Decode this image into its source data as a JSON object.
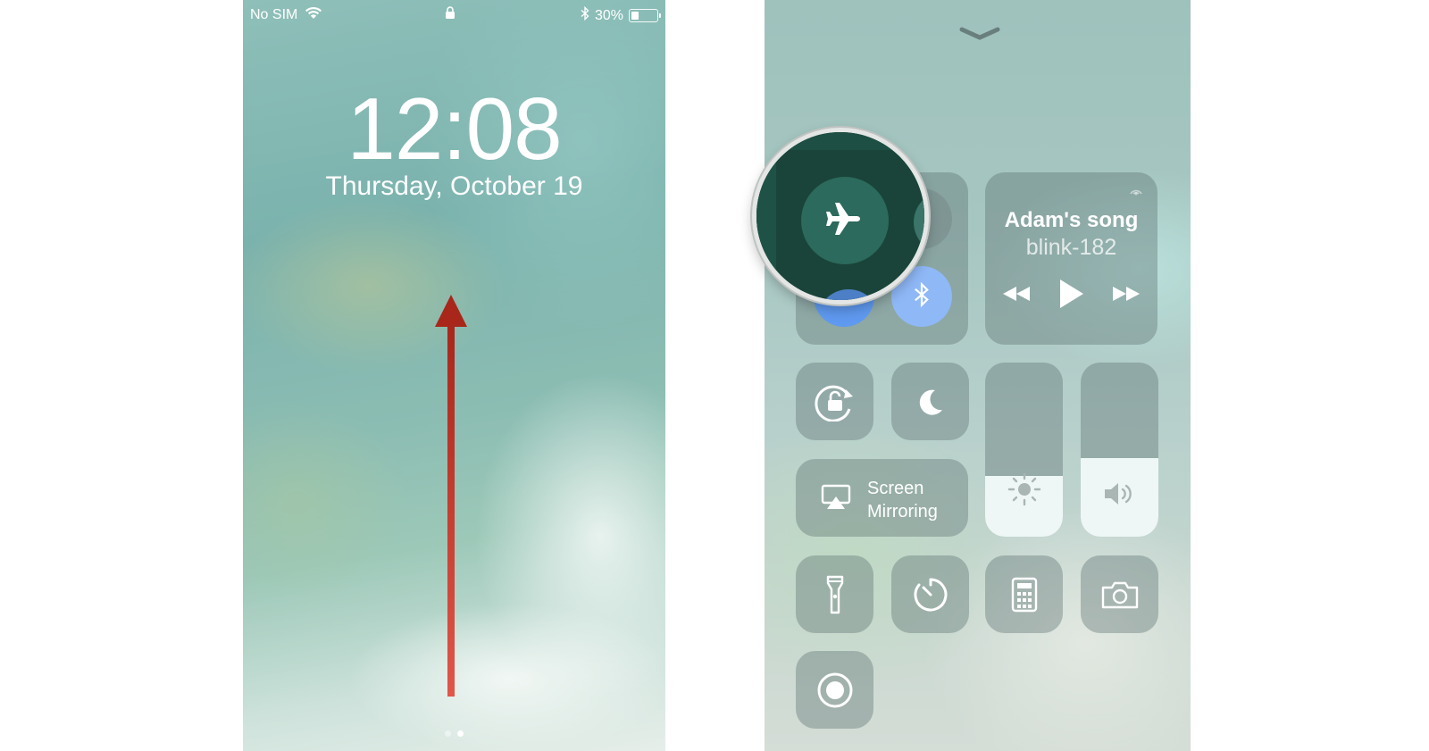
{
  "lock_screen": {
    "status_bar": {
      "carrier": "No SIM",
      "battery_percent": "30%",
      "battery_level": 0.3,
      "icons": [
        "wifi-icon",
        "lock-icon",
        "bluetooth-icon",
        "battery-icon"
      ]
    },
    "time": "12:08",
    "date": "Thursday, October 19",
    "annotation_arrow_color": "#c0392b",
    "page_dots": 2,
    "active_dot": 1
  },
  "control_center": {
    "dismiss_icon": "chevron-down-icon",
    "connectivity": {
      "airplane_icon": "airplane-icon",
      "cellular_icon": "cellular-data-icon",
      "wifi_icon": "wifi-icon",
      "bluetooth_icon": "bluetooth-icon",
      "wifi_color": "#5f9af0",
      "bluetooth_color": "#8fb8f7"
    },
    "now_playing": {
      "title": "Adam's song",
      "artist": "blink-182",
      "controls": [
        "rewind-icon",
        "play-icon",
        "fast-forward-icon"
      ],
      "airplay_icon": "airplay-audio-icon"
    },
    "orientation_lock_icon": "orientation-lock-icon",
    "do_not_disturb_icon": "moon-icon",
    "screen_mirroring": {
      "line1": "Screen",
      "line2": "Mirroring",
      "icon": "airplay-screen-icon"
    },
    "brightness_level": 0.35,
    "volume_level": 0.45,
    "shortcuts": [
      "flashlight-icon",
      "timer-icon",
      "calculator-icon",
      "camera-icon",
      "screen-record-icon"
    ],
    "magnifier_highlight": "airplane-mode-button"
  }
}
